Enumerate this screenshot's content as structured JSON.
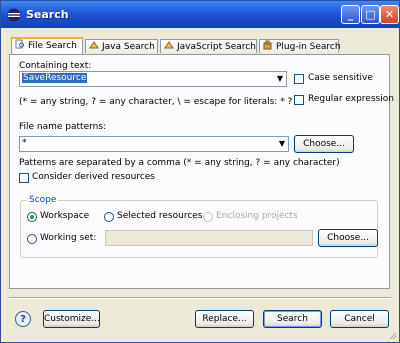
{
  "window": {
    "title": "Search",
    "minimize_icon": "minimize-icon",
    "maximize_icon": "maximize-icon",
    "close_icon": "close-icon"
  },
  "tabs": [
    {
      "label": "File Search",
      "icon": "file-search-icon",
      "active": true
    },
    {
      "label": "Java Search",
      "icon": "java-search-icon",
      "active": false
    },
    {
      "label": "JavaScript Search",
      "icon": "javascript-search-icon",
      "active": false
    },
    {
      "label": "Plug-in Search",
      "icon": "plugin-search-icon",
      "active": false
    }
  ],
  "file_search": {
    "containing_text_label": "Containing text:",
    "containing_text_value": "SaveResource",
    "case_sensitive_label": "Case sensitive",
    "case_sensitive_checked": false,
    "regex_label": "Regular expression",
    "regex_checked": false,
    "hint": "(* = any string, ? = any character, \\ = escape for literals: * ? \\)",
    "file_patterns_label": "File name patterns:",
    "file_patterns_value": "*",
    "choose_label": "Choose...",
    "patterns_hint": "Patterns are separated by a comma (* = any string, ? = any character)",
    "derived_label": "Consider derived resources",
    "derived_checked": false
  },
  "scope": {
    "title": "Scope",
    "workspace_label": "Workspace",
    "selected_resources_label": "Selected resources",
    "enclosing_projects_label": "Enclosing projects",
    "working_set_label": "Working set:",
    "working_set_value": "",
    "choose_label": "Choose...",
    "selected": "Workspace"
  },
  "footer": {
    "help_label": "?",
    "customize_label": "Customize...",
    "replace_label": "Replace...",
    "search_label": "Search",
    "cancel_label": "Cancel"
  }
}
